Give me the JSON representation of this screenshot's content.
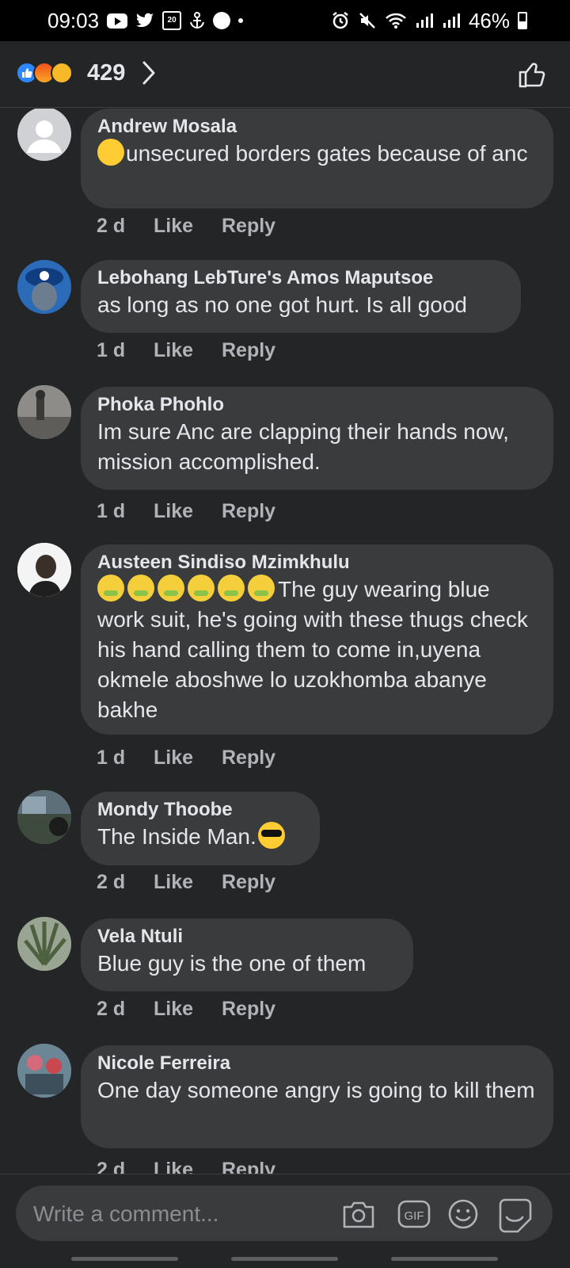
{
  "status_bar": {
    "time": "09:03",
    "calendar_day": "20",
    "battery": "46%"
  },
  "header": {
    "reaction_count": "429"
  },
  "comments": [
    {
      "author": "Andrew Mosala",
      "text": "unsecured borders gates because of anc",
      "age": "2 d",
      "like": "Like",
      "reply": "Reply",
      "emoji": "thinking-face"
    },
    {
      "author": "Lebohang LebTure's Amos Maputsoe",
      "text": "as long as no one got hurt. Is all good",
      "age": "1 d",
      "like": "Like",
      "reply": "Reply"
    },
    {
      "author": "Phoka Phohlo",
      "text": "Im sure Anc are clapping their hands now, mission accomplished.",
      "age": "1 d",
      "like": "Like",
      "reply": "Reply"
    },
    {
      "author": "Austeen Sindiso Mzimkhulu",
      "text": "The guy wearing blue work suit, he's going with these thugs check his hand calling them to come in,uyena okmele aboshwe lo uzokhomba abanye bakhe",
      "age": "1 d",
      "like": "Like",
      "reply": "Reply",
      "emoji": "sick-face x6"
    },
    {
      "author": "Mondy Thoobe",
      "text": "The Inside Man.",
      "age": "2 d",
      "like": "Like",
      "reply": "Reply",
      "emoji": "sunglasses-face"
    },
    {
      "author": "Vela Ntuli",
      "text": "Blue  guy is the one of them",
      "age": "2 d",
      "like": "Like",
      "reply": "Reply"
    },
    {
      "author": "Nicole Ferreira",
      "text": "One day someone angry is going to kill them",
      "age": "2 d",
      "like": "Like",
      "reply": "Reply"
    }
  ],
  "composer": {
    "placeholder": "Write a comment...",
    "gif_label": "GIF"
  },
  "colors": {
    "background": "#242526",
    "bubble": "#3a3b3c",
    "text": "#e4e6eb",
    "meta": "#b0b3b8",
    "like_blue": "#2d88ff"
  }
}
